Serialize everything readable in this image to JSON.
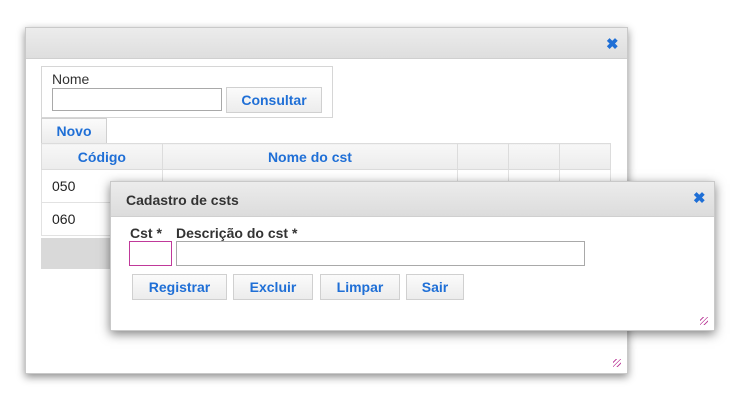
{
  "main_dialog": {
    "search": {
      "label": "Nome",
      "value": "",
      "button": "Consultar"
    },
    "new_button": "Novo",
    "table": {
      "headers": [
        "Código",
        "Nome do cst",
        "",
        "",
        ""
      ],
      "rows": [
        {
          "codigo": "050",
          "nome": ""
        },
        {
          "codigo": "060",
          "nome": ""
        }
      ]
    }
  },
  "modal": {
    "title": "Cadastro de csts",
    "fields": {
      "cst_label": "Cst *",
      "cst_value": "",
      "desc_label": "Descrição do cst *",
      "desc_value": ""
    },
    "buttons": {
      "register": "Registrar",
      "delete": "Excluir",
      "clear": "Limpar",
      "exit": "Sair"
    }
  },
  "icons": {
    "close": "close-icon",
    "resize": "resize-grip-icon"
  },
  "colors": {
    "accent": "#1f6fd6",
    "focus_border": "#c0399a"
  }
}
